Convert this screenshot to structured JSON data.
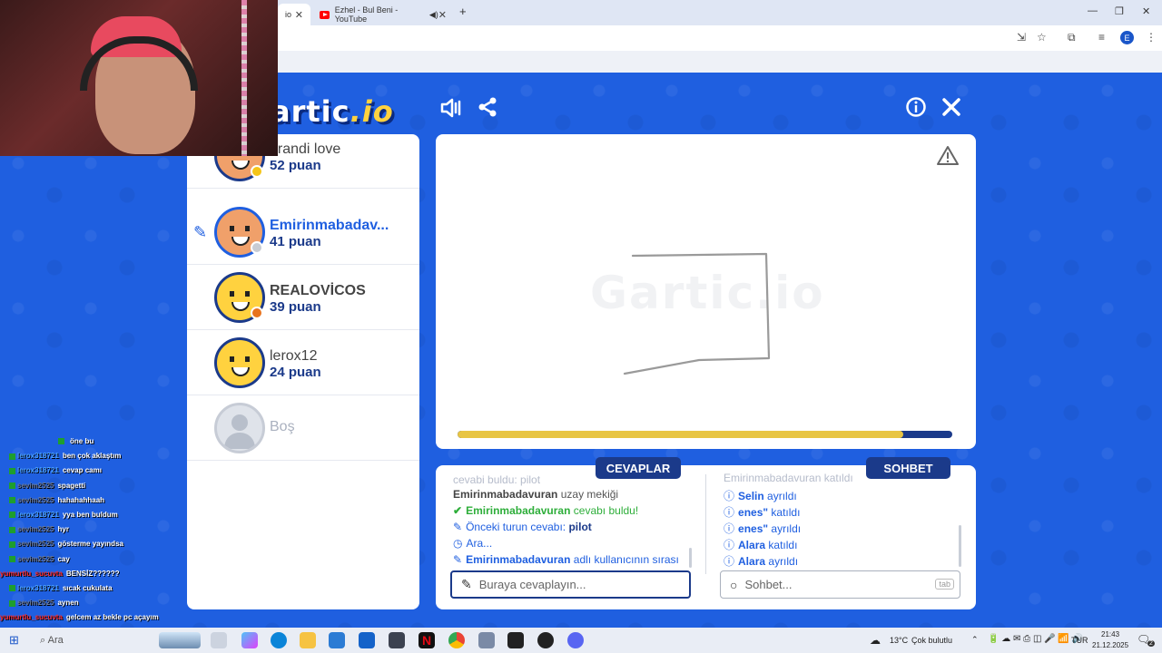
{
  "browser": {
    "tabs": [
      {
        "label": "io",
        "close": "✕"
      },
      {
        "label": "Ezhel - Bul Beni - YouTube",
        "close": "✕"
      }
    ],
    "new_tab": "+",
    "win": {
      "min": "—",
      "max": "❐",
      "close": "✕"
    },
    "profile_initial": "E"
  },
  "game": {
    "logo_main": "artic",
    "logo_io": ".io",
    "watermark": "Gartic.io",
    "timer_fraction": 0.9
  },
  "players": [
    {
      "name": "brandi love",
      "score": "52 puan",
      "status_color": "#f5c518",
      "drawing": false
    },
    {
      "name": "Emirinmabadav...",
      "score": "41 puan",
      "status_color": "#c8ccd4",
      "drawing": true
    },
    {
      "name": "REALOVİCOS",
      "score": "39 puan",
      "status_color": "#e8731e",
      "drawing": false
    },
    {
      "name": "lerox12",
      "score": "24 puan",
      "status_color": "",
      "drawing": false
    }
  ],
  "empty_slot": "Boş",
  "tabs": {
    "answers": "CEVAPLAR",
    "chat": "SOHBET"
  },
  "answers": {
    "top_faded": "cevabi buldu: pilot",
    "line1": {
      "user": "Emirinmabadavuran",
      "text": "uzay mekiği"
    },
    "line2": {
      "user": "Emirinmabadavuran",
      "text": "cevabı buldu!"
    },
    "line3": {
      "text": "Önceki turun cevabı:",
      "value": "pilot"
    },
    "line4": {
      "text": "Ara..."
    },
    "line5": {
      "user": "Emirinmabadavuran",
      "text": "adlı kullanıcının sırası"
    },
    "placeholder": "Buraya cevaplayın..."
  },
  "chat": {
    "top_faded": "Emirinmabadavuran katıldı",
    "lines": [
      {
        "user": "Selin",
        "text": "ayrıldı"
      },
      {
        "user": "enes\"",
        "text": "katıldı"
      },
      {
        "user": "enes\"",
        "text": "ayrıldı"
      },
      {
        "user": "Alara",
        "text": "katıldı"
      },
      {
        "user": "Alara",
        "text": "ayrıldı"
      }
    ],
    "placeholder": "Sohbet...",
    "tab_hint": "tab"
  },
  "twitch": [
    {
      "user": "",
      "msg": "öne bu"
    },
    {
      "user": "lerox318721",
      "msg": "ben çok aklaştım",
      "color": "blue"
    },
    {
      "user": "lerox318721",
      "msg": "cevap camı",
      "color": "blue"
    },
    {
      "user": "sevim2525",
      "msg": "spagetti",
      "color": "gray"
    },
    {
      "user": "sevim2525",
      "msg": "hahahahhaah",
      "color": "gray"
    },
    {
      "user": "lerox318721",
      "msg": "yya ben buldum",
      "color": "blue"
    },
    {
      "user": "sevim2525",
      "msg": "hyr",
      "color": "gray"
    },
    {
      "user": "sevim2525",
      "msg": "gösterme yayındsa",
      "color": "gray"
    },
    {
      "user": "sevim2525",
      "msg": "cay",
      "color": "gray"
    },
    {
      "user": "yumurtlu_sucuvta",
      "msg": "BENSİZ??????",
      "color": "red"
    },
    {
      "user": "lerox318721",
      "msg": "sıcak cukulata",
      "color": "blue"
    },
    {
      "user": "sevim2525",
      "msg": "aynen",
      "color": "gray"
    },
    {
      "user": "yumurtlu_sucuvta",
      "msg": "gelcem az bekle pc açayım",
      "color": "red"
    },
    {
      "user": "sevim2525",
      "msg": "",
      "color": "blue"
    },
    {
      "user": "yumurtlu_sucuvta",
      "msg": "",
      "color": "red"
    }
  ],
  "taskbar": {
    "search": "Ara",
    "weather": "13°C",
    "weather_text": "Çok bulutlu",
    "lang": "TUR",
    "time": "21:43",
    "date": "21.12.2025",
    "notif_count": "2"
  }
}
